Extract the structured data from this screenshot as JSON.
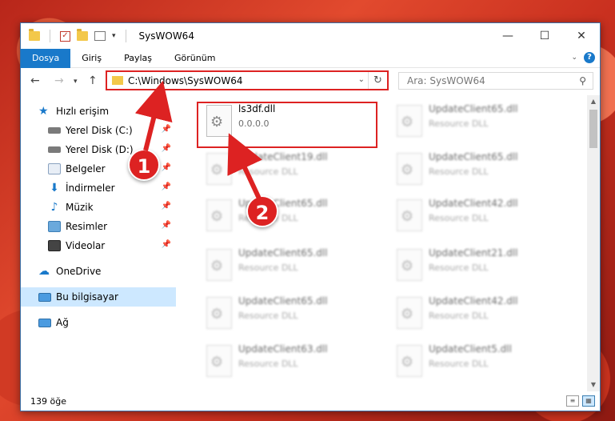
{
  "window": {
    "title": "SysWOW64"
  },
  "ribbon": {
    "tabs": [
      {
        "label": "Dosya",
        "active": true
      },
      {
        "label": "Giriş"
      },
      {
        "label": "Paylaş"
      },
      {
        "label": "Görünüm"
      }
    ]
  },
  "nav": {
    "address": "C:\\Windows\\SysWOW64",
    "search_placeholder": "Ara: SysWOW64"
  },
  "sidebar": {
    "items": [
      {
        "label": "Hızlı erişim",
        "icon": "star-icon"
      },
      {
        "label": "Yerel Disk (C:)",
        "icon": "drive-icon",
        "pinned": true
      },
      {
        "label": "Yerel Disk (D:)",
        "icon": "drive-icon",
        "pinned": true
      },
      {
        "label": "Belgeler",
        "icon": "documents-icon",
        "pinned": true
      },
      {
        "label": "İndirmeler",
        "icon": "downloads-icon",
        "pinned": true
      },
      {
        "label": "Müzik",
        "icon": "music-icon",
        "pinned": true
      },
      {
        "label": "Resimler",
        "icon": "pictures-icon",
        "pinned": true
      },
      {
        "label": "Videolar",
        "icon": "videos-icon",
        "pinned": true
      },
      {
        "label": "OneDrive",
        "icon": "cloud-icon"
      },
      {
        "label": "Bu bilgisayar",
        "icon": "computer-icon",
        "selected": true
      },
      {
        "label": "Ağ",
        "icon": "network-icon"
      }
    ]
  },
  "files": [
    {
      "name": "ls3df.dll",
      "sub": "0.0.0.0"
    },
    {
      "name": "UpdateClient65.dll",
      "sub": "Resource DLL"
    },
    {
      "name": "UpdateClient19.dll",
      "sub": "Resource DLL"
    },
    {
      "name": "UpdateClient65.dll",
      "sub": "Resource DLL"
    },
    {
      "name": "UpdateClient65.dll",
      "sub": "Resource DLL"
    },
    {
      "name": "UpdateClient42.dll",
      "sub": "Resource DLL"
    },
    {
      "name": "UpdateClient65.dll",
      "sub": "Resource DLL"
    },
    {
      "name": "UpdateClient21.dll",
      "sub": "Resource DLL"
    },
    {
      "name": "UpdateClient65.dll",
      "sub": "Resource DLL"
    },
    {
      "name": "UpdateClient42.dll",
      "sub": "Resource DLL"
    },
    {
      "name": "UpdateClient63.dll",
      "sub": "Resource DLL"
    },
    {
      "name": "UpdateClient5.dll",
      "sub": "Resource DLL"
    }
  ],
  "status": {
    "count": "139 öğe"
  },
  "callouts": [
    "1",
    "2"
  ],
  "colors": {
    "accent": "#1979ca",
    "highlight": "#dd2222",
    "selected": "#cde8ff"
  }
}
